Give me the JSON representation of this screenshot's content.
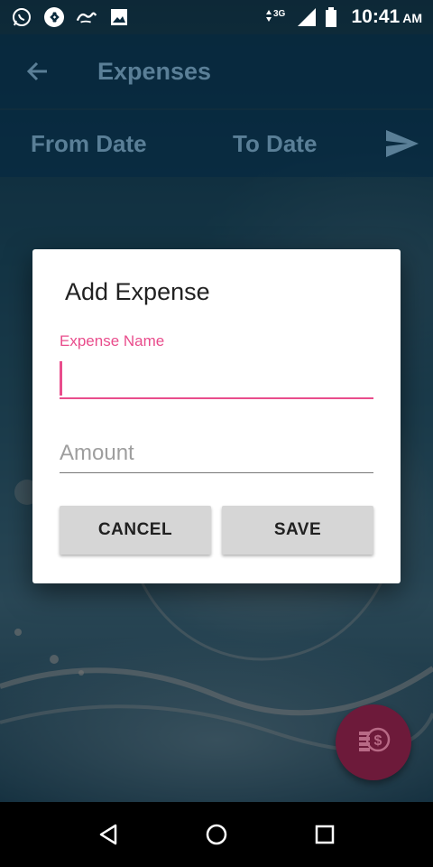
{
  "status_bar": {
    "time": "10:41",
    "ampm": "AM",
    "network": "3G",
    "icons": [
      "whatsapp-icon",
      "shazam-icon",
      "app-icon",
      "gallery-icon",
      "network-icon",
      "signal-icon",
      "battery-icon"
    ]
  },
  "app_bar": {
    "title": "Expenses",
    "back_icon": "arrow-back-icon"
  },
  "date_bar": {
    "from_label": "From Date",
    "to_label": "To Date",
    "send_icon": "send-icon"
  },
  "dialog": {
    "title": "Add Expense",
    "name_field": {
      "label": "Expense Name",
      "value": ""
    },
    "amount_field": {
      "placeholder": "Amount",
      "value": ""
    },
    "cancel_label": "CANCEL",
    "save_label": "SAVE"
  },
  "fab": {
    "icon": "money-icon"
  },
  "nav_bar": {
    "icons": [
      "back-triangle-icon",
      "home-circle-icon",
      "recents-square-icon"
    ]
  },
  "colors": {
    "accent": "#e94d8c",
    "fab": "#6d1a3a",
    "bar": "#032842",
    "dim_text": "#5a7f97"
  }
}
